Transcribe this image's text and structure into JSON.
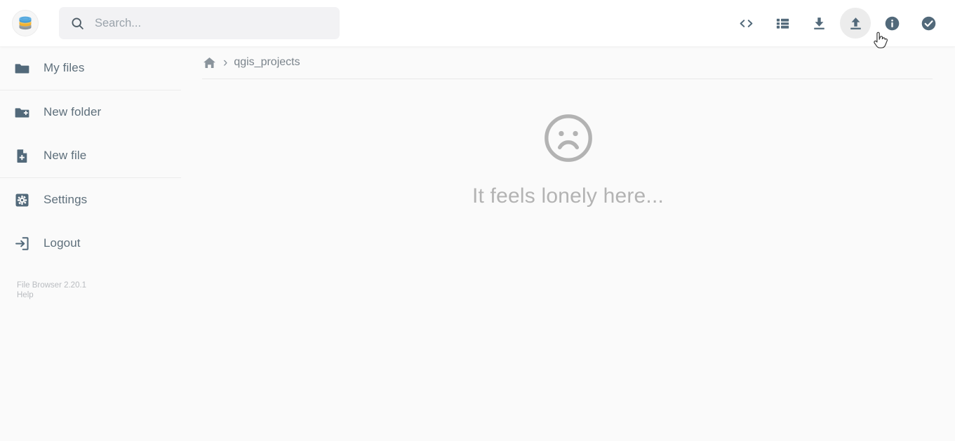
{
  "app": {
    "name": "File Browser",
    "logo_icon": "database-stack-logo",
    "logo_colors": {
      "top": "#4a9fd6",
      "middle": "#f2b231",
      "bottom": "#8d9499"
    }
  },
  "header": {
    "search": {
      "placeholder": "Search...",
      "value": "",
      "icon": "search-icon"
    },
    "actions": [
      {
        "name": "toggle-shell",
        "icon": "code-brackets-icon",
        "label": "<>",
        "hovered": false
      },
      {
        "name": "switch-view",
        "icon": "list-view-icon",
        "label": "List view",
        "hovered": false
      },
      {
        "name": "download",
        "icon": "download-icon",
        "label": "Download",
        "hovered": false
      },
      {
        "name": "upload",
        "icon": "upload-icon",
        "label": "Upload",
        "hovered": true
      },
      {
        "name": "file-info",
        "icon": "info-circle-icon",
        "label": "Info",
        "hovered": false
      },
      {
        "name": "select-multiple",
        "icon": "check-circle-icon",
        "label": "Select",
        "hovered": false
      }
    ]
  },
  "sidebar": {
    "items": [
      {
        "label": "My files",
        "icon": "folder-icon"
      },
      {
        "label": "New folder",
        "icon": "folder-plus-icon"
      },
      {
        "label": "New file",
        "icon": "file-plus-icon"
      },
      {
        "label": "Settings",
        "icon": "gear-icon"
      },
      {
        "label": "Logout",
        "icon": "logout-icon"
      }
    ],
    "footer": {
      "version": "File Browser 2.20.1",
      "help": "Help"
    }
  },
  "main": {
    "breadcrumb": {
      "home_icon": "home-icon",
      "separator": "›",
      "items": [
        "qgis_projects"
      ]
    },
    "empty_state": {
      "icon": "sad-face-icon",
      "message": "It feels lonely here..."
    }
  },
  "colors": {
    "icon": "#52697a",
    "text": "#5e6f7b",
    "muted": "#b3b3b3",
    "background": "#fafafa",
    "header_background": "#ffffff",
    "search_background": "#f2f2f4",
    "hover_background": "#ececec"
  },
  "cursor": {
    "type": "pointer-hand"
  }
}
